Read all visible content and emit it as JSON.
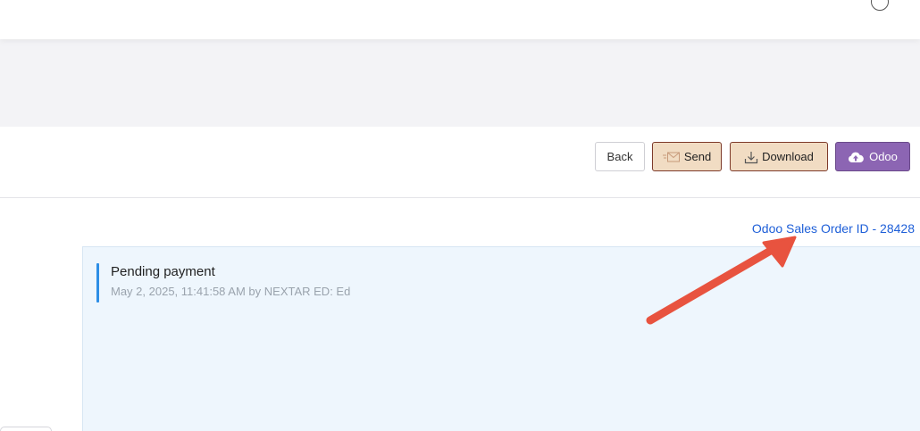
{
  "toolbar": {
    "back_label": "Back",
    "send_label": "Send",
    "download_label": "Download",
    "odoo_label": "Odoo"
  },
  "order": {
    "link_text": "Odoo Sales Order ID - 28428"
  },
  "activity": {
    "title": "Pending payment",
    "meta": "May 2, 2025, 11:41:58 AM by NEXTAR ED: Ed"
  },
  "icons": {
    "help": "help-icon",
    "send": "envelope-icon",
    "download": "download-icon",
    "odoo": "cloud-upload-icon",
    "annotation": "arrow-icon"
  },
  "colors": {
    "accent_blue": "#1e5fd8",
    "activity_bar": "#2d8ee6",
    "send_bg": "#f1dcc3",
    "odoo_bg": "#8c65b3",
    "arrow": "#e8533f"
  }
}
